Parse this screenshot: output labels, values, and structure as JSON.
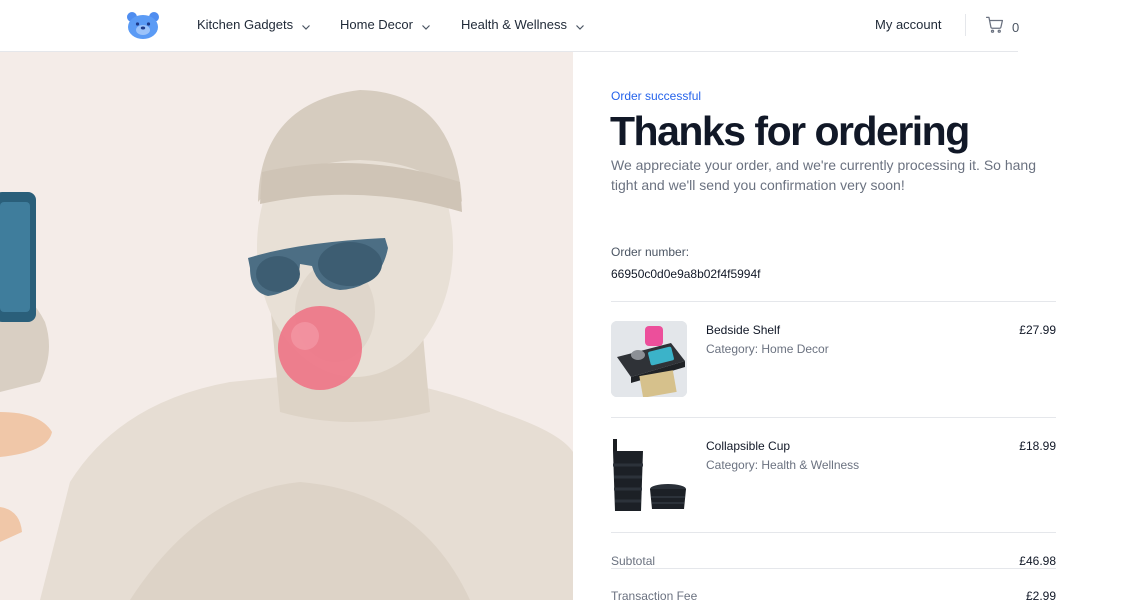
{
  "header": {
    "logo_icon": "bear-face-logo",
    "nav": [
      {
        "label": "Kitchen Gadgets"
      },
      {
        "label": "Home Decor"
      },
      {
        "label": "Health & Wellness"
      }
    ],
    "account_label": "My account",
    "cart_count": "0"
  },
  "hero": {
    "image": "statue-with-sunglasses-and-bubblegum"
  },
  "order": {
    "status": "Order successful",
    "title": "Thanks for ordering",
    "message": "We appreciate your order, and we're currently processing it. So hang tight and we'll send you confirmation very soon!",
    "number_label": "Order number:",
    "number": "66950c0d0e9a8b02f4f5994f",
    "items": [
      {
        "name": "Bedside Shelf",
        "category": "Category: Home Decor",
        "price": "£27.99",
        "image": "bedside-shelf-photo"
      },
      {
        "name": "Collapsible Cup",
        "category": "Category: Health & Wellness",
        "price": "£18.99",
        "image": "collapsible-cup-photo"
      }
    ],
    "subtotal_label": "Subtotal",
    "subtotal": "£46.98",
    "fee_label": "Transaction Fee",
    "fee": "£2.99"
  },
  "colors": {
    "accent": "#2563eb",
    "hero_bg": "#f4ece8",
    "logo": "#4f8df0"
  }
}
